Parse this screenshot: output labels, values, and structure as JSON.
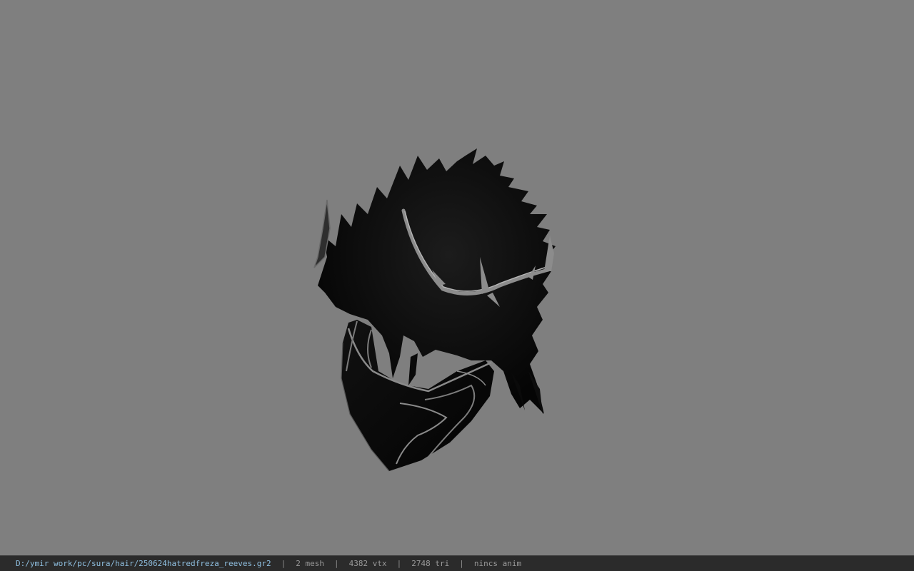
{
  "viewer": {
    "background": "#7f7f7f",
    "model_icon": "3d-hair-model"
  },
  "status": {
    "path": "D:/ymir work/pc/sura/hair/250624hatredfreza_reeves.gr2",
    "separator": "|",
    "mesh": "2 mesh",
    "vtx": "4382 vtx",
    "tri": "2748 tri",
    "anim": "nincs anim"
  }
}
